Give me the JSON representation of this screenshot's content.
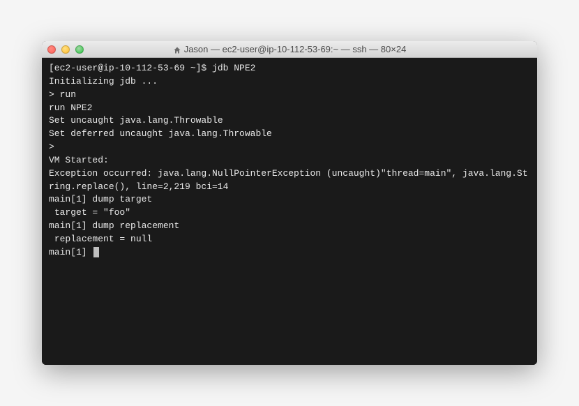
{
  "window": {
    "title": "Jason — ec2-user@ip-10-112-53-69:~ — ssh — 80×24"
  },
  "terminal": {
    "lines": [
      "[ec2-user@ip-10-112-53-69 ~]$ jdb NPE2",
      "Initializing jdb ...",
      "> run",
      "run NPE2",
      "Set uncaught java.lang.Throwable",
      "Set deferred uncaught java.lang.Throwable",
      ">",
      "VM Started:",
      "Exception occurred: java.lang.NullPointerException (uncaught)\"thread=main\", java.lang.String.replace(), line=2,219 bci=14",
      "",
      "main[1] dump target",
      " target = \"foo\"",
      "main[1] dump replacement",
      " replacement = null",
      "main[1] "
    ]
  }
}
